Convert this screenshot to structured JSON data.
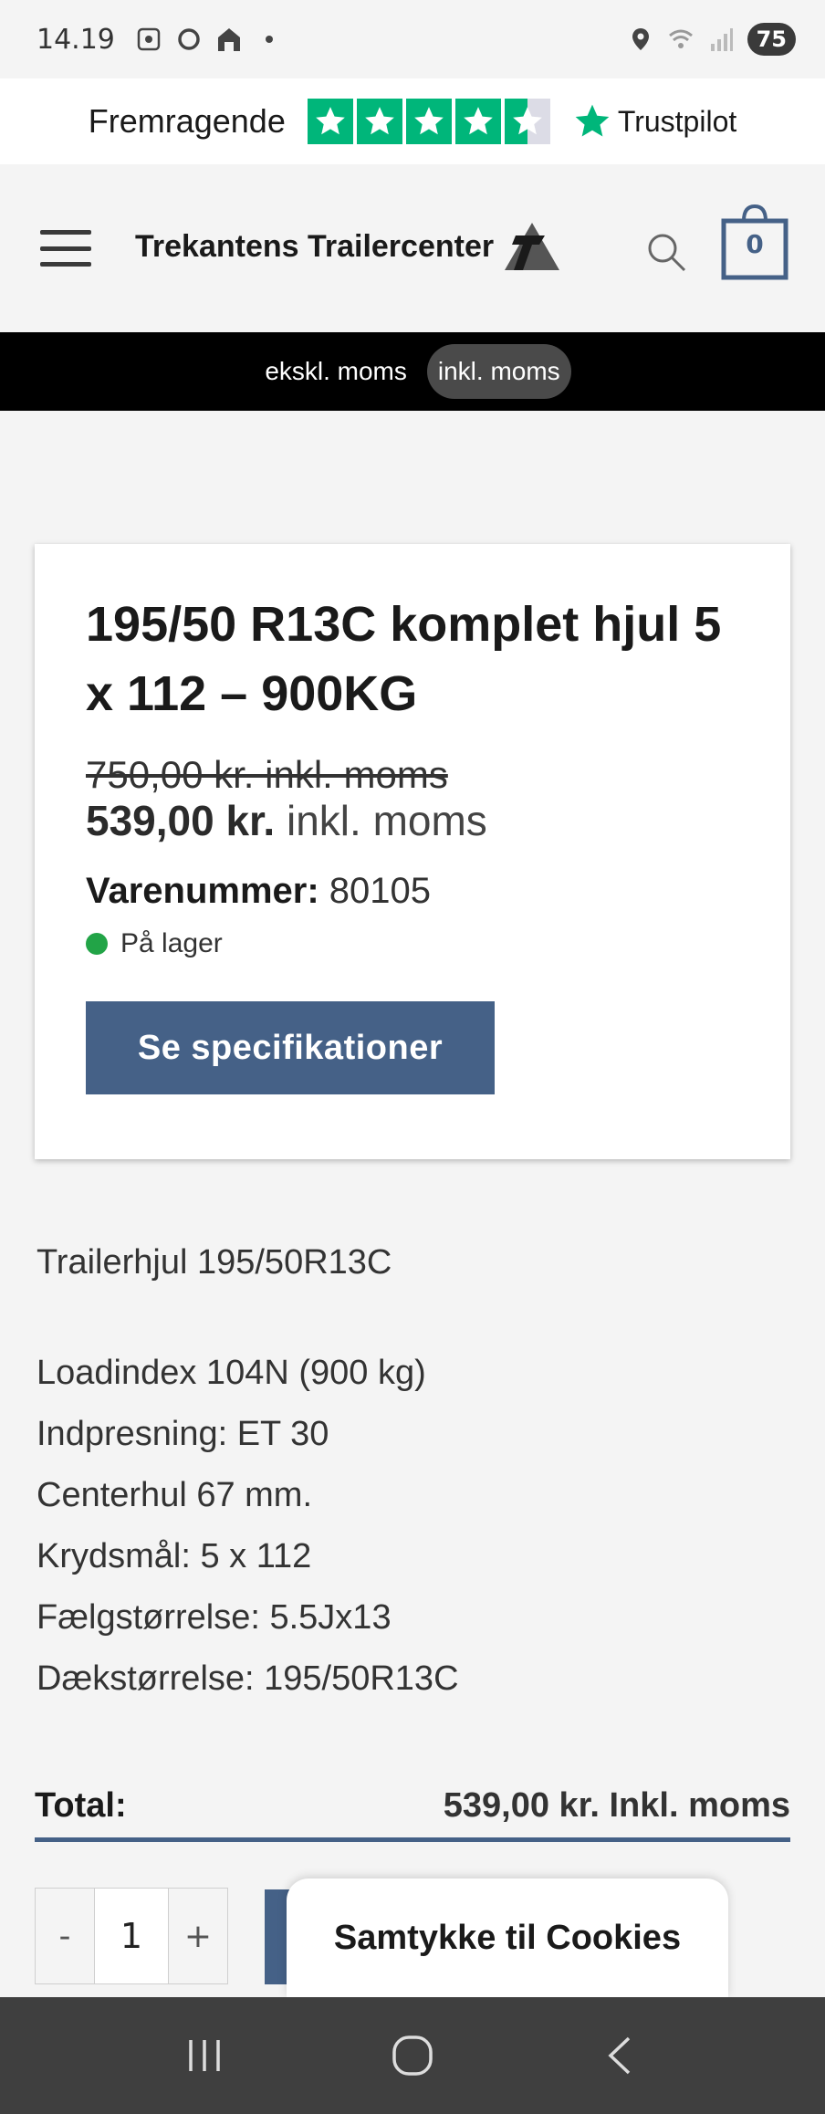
{
  "status_bar": {
    "time": "14.19",
    "battery": "75"
  },
  "trustpilot": {
    "rating_label": "Fremragende",
    "brand": "Trustpilot",
    "stars": 4.5
  },
  "header": {
    "logo_text": "Trekantens Trailercenter",
    "cart_count": "0"
  },
  "vat_toggle": {
    "excl_label": "ekskl. moms",
    "incl_label": "inkl. moms",
    "active": "incl"
  },
  "product": {
    "title": "195/50 R13C komplet hjul 5 x 112 – 900KG",
    "old_price": "750,00 kr.  inkl. moms",
    "price": "539,00 kr.",
    "price_suffix": "inkl. moms",
    "sku_label": "Varenummer:",
    "sku_value": "80105",
    "stock_text": "På lager",
    "spec_button": "Se specifikationer"
  },
  "description": {
    "intro": "Trailerhjul 195/50R13C",
    "lines": [
      "Loadindex 104N (900 kg)",
      "Indpresning: ET 30",
      "Centerhul 67 mm.",
      "Krydsmål: 5 x 112",
      "Fælgstørrelse: 5.5Jx13",
      "Dækstørrelse: 195/50R13C"
    ]
  },
  "total": {
    "label": "Total:",
    "value": "539,00 kr. Inkl. moms"
  },
  "quantity": {
    "minus": "-",
    "value": "1",
    "plus": "+"
  },
  "cookie_popup": {
    "title": "Samtykke til Cookies"
  },
  "colors": {
    "accent": "#456187",
    "trustpilot_green": "#00b67a",
    "stock_green": "#22a447"
  }
}
